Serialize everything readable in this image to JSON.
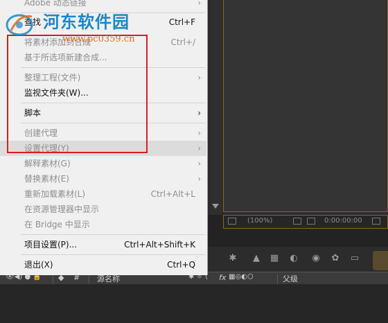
{
  "menu": {
    "items": [
      {
        "label": "Adobe 动态链接",
        "shortcut": "",
        "submenu": true,
        "enabled": true
      },
      {
        "label": "查找",
        "shortcut": "Ctrl+F",
        "submenu": false,
        "enabled": true
      },
      {
        "label": "将素材添加到合成",
        "shortcut": "Ctrl+/",
        "submenu": false,
        "enabled": false
      },
      {
        "label": "基于所选项新建合成...",
        "shortcut": "",
        "submenu": false,
        "enabled": false
      },
      {
        "label": "整理工程(文件)",
        "shortcut": "",
        "submenu": true,
        "enabled": false
      },
      {
        "label": "监视文件夹(W)...",
        "shortcut": "",
        "submenu": false,
        "enabled": true
      },
      {
        "label": "脚本",
        "shortcut": "",
        "submenu": true,
        "enabled": true
      },
      {
        "label": "创建代理",
        "shortcut": "",
        "submenu": true,
        "enabled": false
      },
      {
        "label": "设置代理(Y)",
        "shortcut": "",
        "submenu": true,
        "enabled": false
      },
      {
        "label": "解释素材(G)",
        "shortcut": "",
        "submenu": true,
        "enabled": false
      },
      {
        "label": "替换素材(E)",
        "shortcut": "",
        "submenu": true,
        "enabled": false
      },
      {
        "label": "重新加载素材(L)",
        "shortcut": "Ctrl+Alt+L",
        "submenu": false,
        "enabled": false
      },
      {
        "label": "在资源管理器中显示",
        "shortcut": "",
        "submenu": false,
        "enabled": false
      },
      {
        "label": "在 Bridge 中显示",
        "shortcut": "",
        "submenu": false,
        "enabled": false
      },
      {
        "label": "项目设置(P)...",
        "shortcut": "Ctrl+Alt+Shift+K",
        "submenu": false,
        "enabled": true
      },
      {
        "label": "退出(X)",
        "shortcut": "Ctrl+Q",
        "submenu": false,
        "enabled": true
      }
    ]
  },
  "composition": {
    "zoom": "(100%)",
    "timecode": "0:00:00:00"
  },
  "timeline_header": {
    "source_name": "源名称",
    "parent": "父级",
    "fx": "fx",
    "hash": "#"
  },
  "watermark": {
    "title": "河东软件园",
    "url": "www.pc0359.cn"
  },
  "colors": {
    "annotation_red": "#d81e1e",
    "comp_border": "#8a6a1a",
    "watermark_blue": "#1c86c9",
    "watermark_orange": "#e06a1a"
  }
}
